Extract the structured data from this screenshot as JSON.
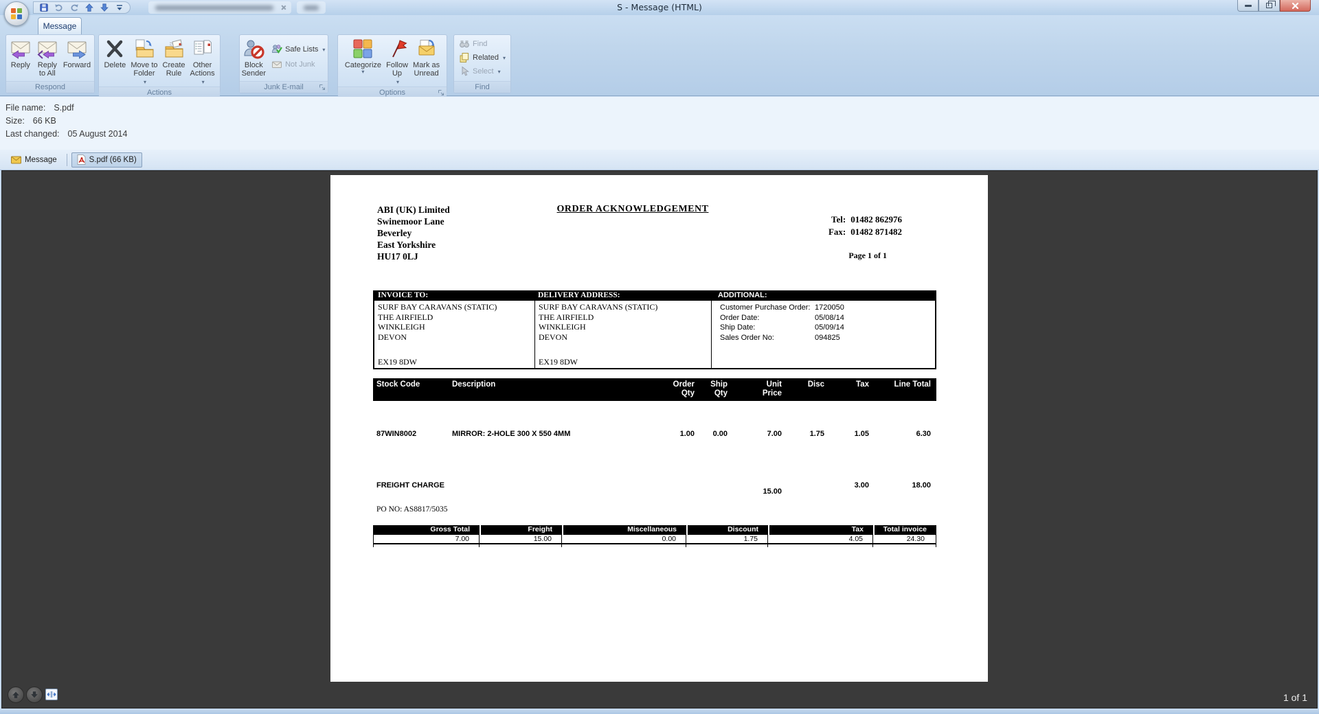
{
  "window": {
    "title": "S - Message (HTML)"
  },
  "icons": {
    "office-orb": "office-logo-circle",
    "save-icon": "floppy-disk",
    "undo-icon": "curved-arrow-left",
    "redo-icon": "curved-arrow-right",
    "previous-item-icon": "blue-arrow-up",
    "next-item-icon": "blue-arrow-down",
    "qat-customize-icon": "bar-with-caret",
    "minimize-icon": "horizontal-bar",
    "restore-icon": "overlapping-squares",
    "close-icon": "x-mark",
    "reply-icon": "envelope-purple-arrow-left",
    "reply-all-icon": "envelope-double-purple-arrow",
    "forward-icon": "envelope-blue-arrow-right",
    "delete-icon": "black-x",
    "move-to-folder-icon": "folder-blue-arrow-page",
    "create-rule-icon": "folder-with-envelope",
    "other-actions-icon": "list-page-pair",
    "block-sender-icon": "person-no-entry-sign",
    "safe-lists-icon": "people-green-check",
    "not-junk-icon": "gray-envelope",
    "categorize-icon": "four-color-squares",
    "follow-up-icon": "red-flag",
    "mark-as-unread-icon": "envelope-blue-curved-arrow",
    "find-icon": "binoculars",
    "related-icon": "stacked-yellow-pages",
    "select-icon": "cursor-arrow",
    "dialog-launcher-icon": "corner-arrow-box",
    "message-tab-icon": "yellow-envelope",
    "pdf-icon": "adobe-pdf-page",
    "nav-up-icon": "circle-arrow-up",
    "nav-down-icon": "circle-arrow-down",
    "fit-width-icon": "page-horizontal-arrows",
    "dropdown-caret": "▾"
  },
  "ribbon": {
    "active_tab": "Message",
    "groups": {
      "respond": {
        "label": "Respond",
        "reply": "Reply",
        "reply_all": "Reply\nto All",
        "forward": "Forward"
      },
      "actions": {
        "label": "Actions",
        "delete": "Delete",
        "move_to_folder": "Move to\nFolder",
        "create_rule": "Create\nRule",
        "other_actions": "Other\nActions"
      },
      "junk": {
        "label": "Junk E-mail",
        "block_sender": "Block\nSender",
        "safe_lists": "Safe Lists",
        "not_junk": "Not Junk"
      },
      "options": {
        "label": "Options",
        "categorize": "Categorize",
        "follow_up": "Follow\nUp",
        "mark_unread": "Mark as\nUnread"
      },
      "find": {
        "label": "Find",
        "find": "Find",
        "related": "Related",
        "select": "Select"
      }
    }
  },
  "file_info": {
    "rows": [
      {
        "label": "File name:",
        "value": "S.pdf"
      },
      {
        "label": "Size:",
        "value": "66 KB"
      },
      {
        "label": "Last changed:",
        "value": "05 August 2014"
      }
    ]
  },
  "attachment_bar": {
    "message_tab": "Message",
    "attachment_tab": "S.pdf (66 KB)"
  },
  "document": {
    "company_lines": [
      "ABI (UK) Limited",
      "Swinemoor Lane",
      "Beverley",
      "East Yorkshire",
      "HU17 0LJ"
    ],
    "title": "ORDER ACKNOWLEDGEMENT",
    "tel_label": "Tel:",
    "tel_value": "01482 862976",
    "fax_label": "Fax:",
    "fax_value": "01482 871482",
    "page_label": "Page 1 of 1",
    "address_table": {
      "invoice_header": "INVOICE TO:",
      "delivery_header": "DELIVERY ADDRESS:",
      "additional_header": "ADDITIONAL:",
      "invoice_lines": [
        "SURF BAY CARAVANS (STATIC)",
        "THE AIRFIELD",
        "WINKLEIGH",
        "DEVON"
      ],
      "invoice_postcode": "EX19 8DW",
      "delivery_lines": [
        "SURF BAY CARAVANS (STATIC)",
        "THE AIRFIELD",
        "WINKLEIGH",
        "DEVON"
      ],
      "delivery_postcode": "EX19 8DW",
      "additional_rows": [
        {
          "label": "Customer Purchase Order:",
          "value": "1720050"
        },
        {
          "label": "Order Date:",
          "value": "05/08/14"
        },
        {
          "label": "Ship Date:",
          "value": "05/09/14"
        },
        {
          "label": "Sales Order No:",
          "value": "094825"
        }
      ]
    },
    "items_table": {
      "headers": [
        "Stock Code",
        "Description",
        "Order\nQty",
        "Ship\nQty",
        "Unit\nPrice",
        "Disc",
        "Tax",
        "Line Total"
      ],
      "rows": [
        {
          "stock_code": "87WIN8002",
          "description": "MIRROR: 2-HOLE 300 X 550 4MM",
          "order_qty": "1.00",
          "ship_qty": "0.00",
          "unit_price": "7.00",
          "disc": "1.75",
          "tax": "1.05",
          "line_total": "6.30"
        }
      ],
      "freight_row": {
        "description": "FREIGHT CHARGE",
        "unit_price": "15.00",
        "tax": "3.00",
        "line_total": "18.00"
      }
    },
    "po_no": "PO NO: AS8817/5035",
    "totals_table": {
      "headers": [
        "Gross Total",
        "Freight",
        "Miscellaneous",
        "Discount",
        "Tax",
        "Total invoice"
      ],
      "values": [
        "7.00",
        "15.00",
        "0.00",
        "1.75",
        "4.05",
        "24.30"
      ]
    }
  },
  "preview_nav": {
    "page_indicator": "1 of 1"
  }
}
